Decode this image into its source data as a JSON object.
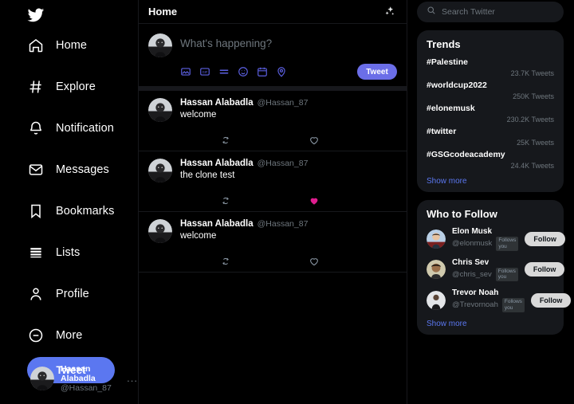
{
  "sidebar": {
    "logo_icon": "twitter-bird-icon",
    "items": [
      {
        "label": "Home",
        "icon": "home-icon"
      },
      {
        "label": "Explore",
        "icon": "hashtag-icon"
      },
      {
        "label": "Notification",
        "icon": "bell-icon"
      },
      {
        "label": "Messages",
        "icon": "envelope-icon"
      },
      {
        "label": "Bookmarks",
        "icon": "bookmark-icon"
      },
      {
        "label": "Lists",
        "icon": "lists-icon"
      },
      {
        "label": "Profile",
        "icon": "person-icon"
      },
      {
        "label": "More",
        "icon": "more-circle-icon"
      }
    ],
    "tweet_button": "Tweet",
    "profile": {
      "name": "Hassan Alabadla",
      "handle": "@Hassan_87",
      "more_dots": "..."
    }
  },
  "feed": {
    "title": "Home",
    "sparkle_icon": "sparkles-icon",
    "composer": {
      "placeholder": "What's happening?",
      "value": "",
      "tweet_button": "Tweet",
      "icons": [
        "image-icon",
        "gif-icon",
        "poll-icon",
        "emoji-icon",
        "schedule-icon",
        "location-icon"
      ]
    },
    "tweets": [
      {
        "name": "Hassan Alabadla",
        "handle": "@Hassan_87",
        "text": "welcome",
        "liked": false
      },
      {
        "name": "Hassan Alabadla",
        "handle": "@Hassan_87",
        "text": "the clone test",
        "liked": true
      },
      {
        "name": "Hassan Alabadla",
        "handle": "@Hassan_87",
        "text": "welcome",
        "liked": false
      }
    ]
  },
  "right": {
    "search": {
      "placeholder": "Search Twitter",
      "value": "",
      "icon": "search-icon"
    },
    "trends": {
      "title": "Trends",
      "items": [
        {
          "tag": "#Palestine",
          "count": "23.7K Tweets"
        },
        {
          "tag": "#worldcup2022",
          "count": "250K Tweets"
        },
        {
          "tag": "#elonemusk",
          "count": "230.2K Tweets"
        },
        {
          "tag": "#twitter",
          "count": "25K Tweets"
        },
        {
          "tag": "#GSGcodeacademy",
          "count": "24.4K Tweets"
        }
      ],
      "show_more": "Show more"
    },
    "who_to_follow": {
      "title": "Who to Follow",
      "items": [
        {
          "name": "Elon Musk",
          "handle": "@elonmusk",
          "badge": "Follows you",
          "button": "Follow"
        },
        {
          "name": "Chris Sev",
          "handle": "@chris_sev",
          "badge": "Follows you",
          "button": "Follow"
        },
        {
          "name": "Trevor Noah",
          "handle": "@Trevornoah",
          "badge": "Follows you",
          "button": "Follow"
        }
      ],
      "show_more": "Show more"
    }
  },
  "colors": {
    "page_bg": "#000000",
    "panel_bg": "#16181c",
    "accent_blue": "#5b77f0",
    "composer_accent": "#6b6ee8",
    "like_pink": "#e01d8f",
    "muted_text": "#6e767d",
    "follow_btn": "#d9d9d9"
  }
}
